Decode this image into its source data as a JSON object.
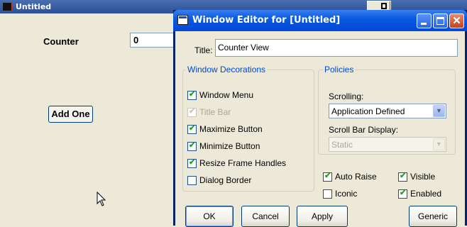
{
  "app": {
    "title": "Untitled",
    "counter_label": "Counter",
    "counter_value": "0",
    "add_button": "Add One"
  },
  "dialog": {
    "title": "Window Editor for [Untitled]",
    "title_field_label": "Title:",
    "title_field_value": "Counter View",
    "window_decorations": {
      "title": "Window Decorations",
      "items": [
        {
          "label": "Window Menu",
          "checked": true,
          "disabled": false
        },
        {
          "label": "Title Bar",
          "checked": true,
          "disabled": true
        },
        {
          "label": "Maximize Button",
          "checked": true,
          "disabled": false
        },
        {
          "label": "Minimize Button",
          "checked": true,
          "disabled": false
        },
        {
          "label": "Resize Frame Handles",
          "checked": true,
          "disabled": false
        },
        {
          "label": "Dialog Border",
          "checked": false,
          "disabled": false
        }
      ]
    },
    "policies": {
      "title": "Policies",
      "scrolling_label": "Scrolling:",
      "scrolling_value": "Application Defined",
      "scrollbar_label": "Scroll Bar Display:",
      "scrollbar_value": "Static"
    },
    "options": [
      {
        "label": "Auto Raise",
        "checked": true
      },
      {
        "label": "Iconic",
        "checked": false
      },
      {
        "label": "Visible",
        "checked": true
      },
      {
        "label": "Enabled",
        "checked": true
      }
    ],
    "buttons": {
      "ok": "OK",
      "cancel": "Cancel",
      "apply": "Apply",
      "generic": "Generic"
    }
  },
  "colors": {
    "group_title": "#0046d5",
    "titlebar": "#0a5ae0",
    "checkmark": "#21a121"
  }
}
